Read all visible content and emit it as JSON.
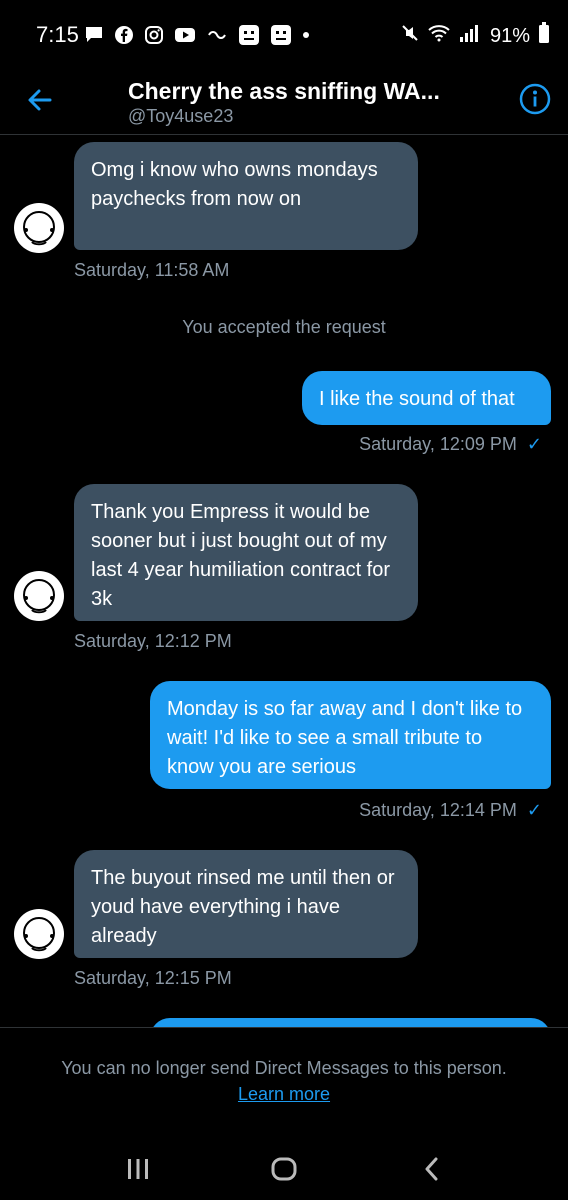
{
  "status_bar": {
    "time": "7:15",
    "battery": "91%"
  },
  "header": {
    "title": "Cherry the ass sniffing WA...",
    "handle": "@Toy4use23"
  },
  "messages": [
    {
      "text": "Omg i know who owns mondays paychecks from now on",
      "timestamp": "Saturday, 11:58 AM"
    },
    {
      "text": "You accepted the request"
    },
    {
      "text": "I like the sound of that",
      "timestamp": "Saturday, 12:09 PM"
    },
    {
      "text": "Thank you Empress it would be sooner but i just bought out of my last 4 year humiliation contract for 3k",
      "timestamp": "Saturday, 12:12 PM"
    },
    {
      "text": "Monday is so far away and I don't like to wait! I'd like to see a small tribute to know you are serious",
      "timestamp": "Saturday, 12:14 PM"
    },
    {
      "text": "The buyout rinsed me until then or youd have everything i have already",
      "timestamp": "Saturday, 12:15 PM"
    }
  ],
  "footer": {
    "notice": "You can no longer send Direct Messages to this person.",
    "link": "Learn more"
  },
  "colors": {
    "accent": "#1d9bf0",
    "incoming_bubble": "#3d5061",
    "background": "#000000"
  }
}
